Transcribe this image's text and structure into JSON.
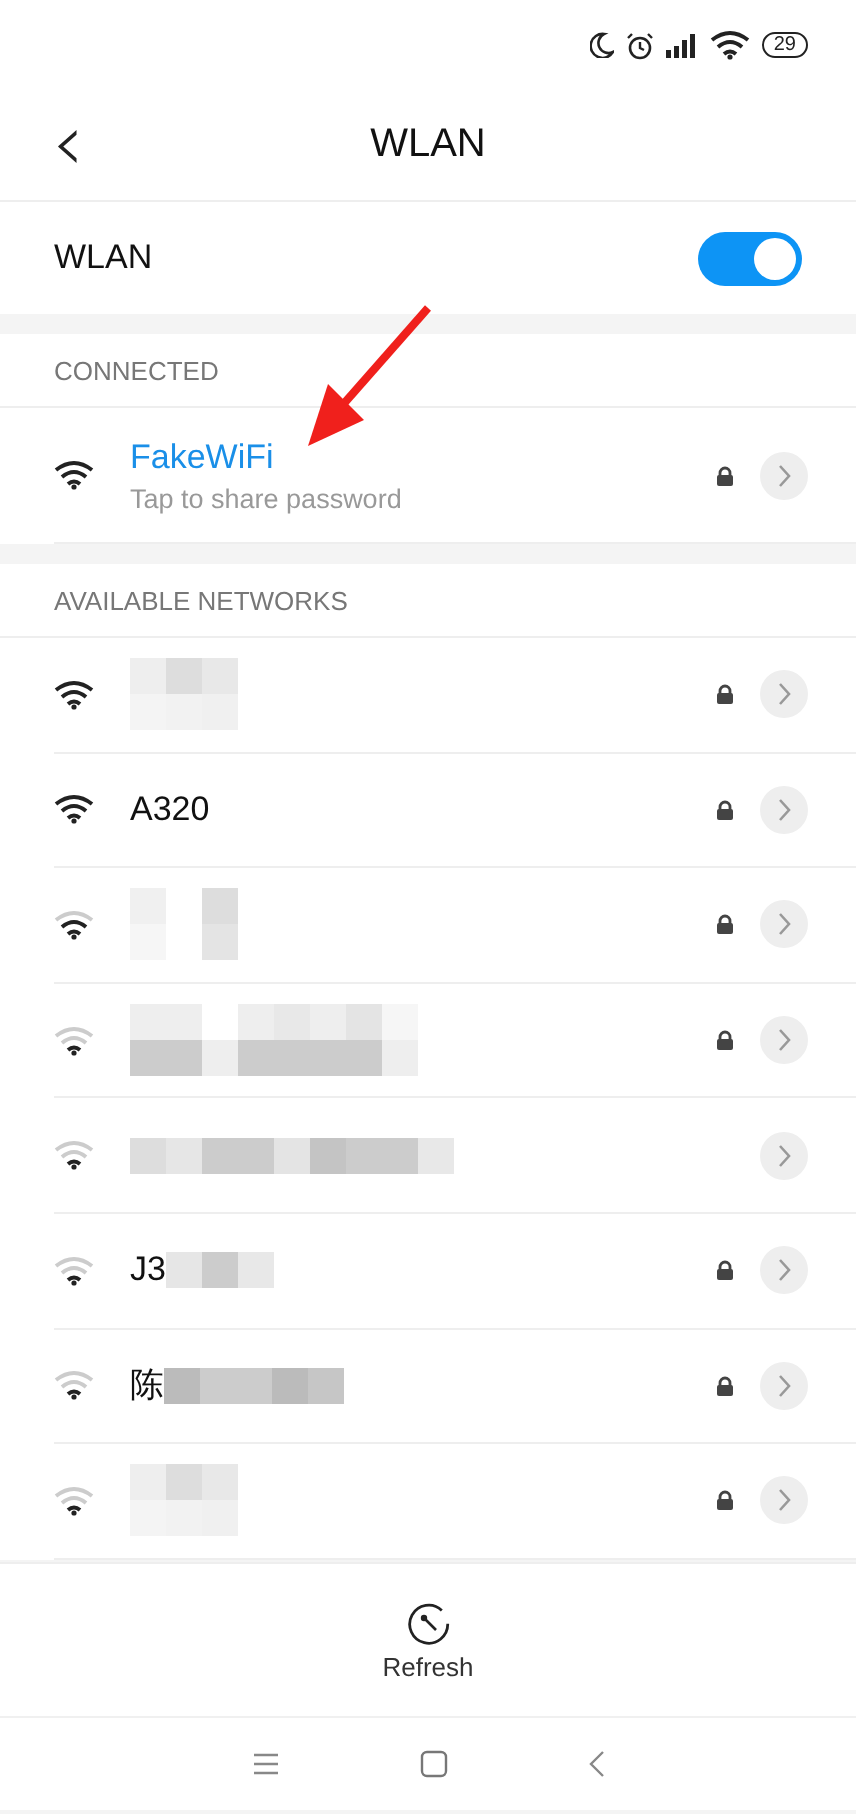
{
  "status_bar": {
    "battery": "29"
  },
  "header": {
    "title": "WLAN",
    "back": "‹"
  },
  "wlan_toggle": {
    "label": "WLAN",
    "on": true
  },
  "connected": {
    "heading": "CONNECTED",
    "network": {
      "name": "FakeWiFi",
      "subtitle": "Tap to share password",
      "redacted": false,
      "locked": true
    }
  },
  "available": {
    "heading": "AVAILABLE NETWORKS",
    "networks": [
      {
        "redacted": true,
        "locked": true
      },
      {
        "name": "A320",
        "redacted": false,
        "locked": true
      },
      {
        "redacted": true,
        "locked": true
      },
      {
        "redacted": true,
        "locked": true
      },
      {
        "redacted": true,
        "locked": false
      },
      {
        "name": "J3",
        "redacted": true,
        "locked": true
      },
      {
        "name": "陈",
        "redacted": true,
        "locked": true
      },
      {
        "redacted": true,
        "locked": true
      }
    ]
  },
  "refresh": {
    "label": "Refresh"
  }
}
